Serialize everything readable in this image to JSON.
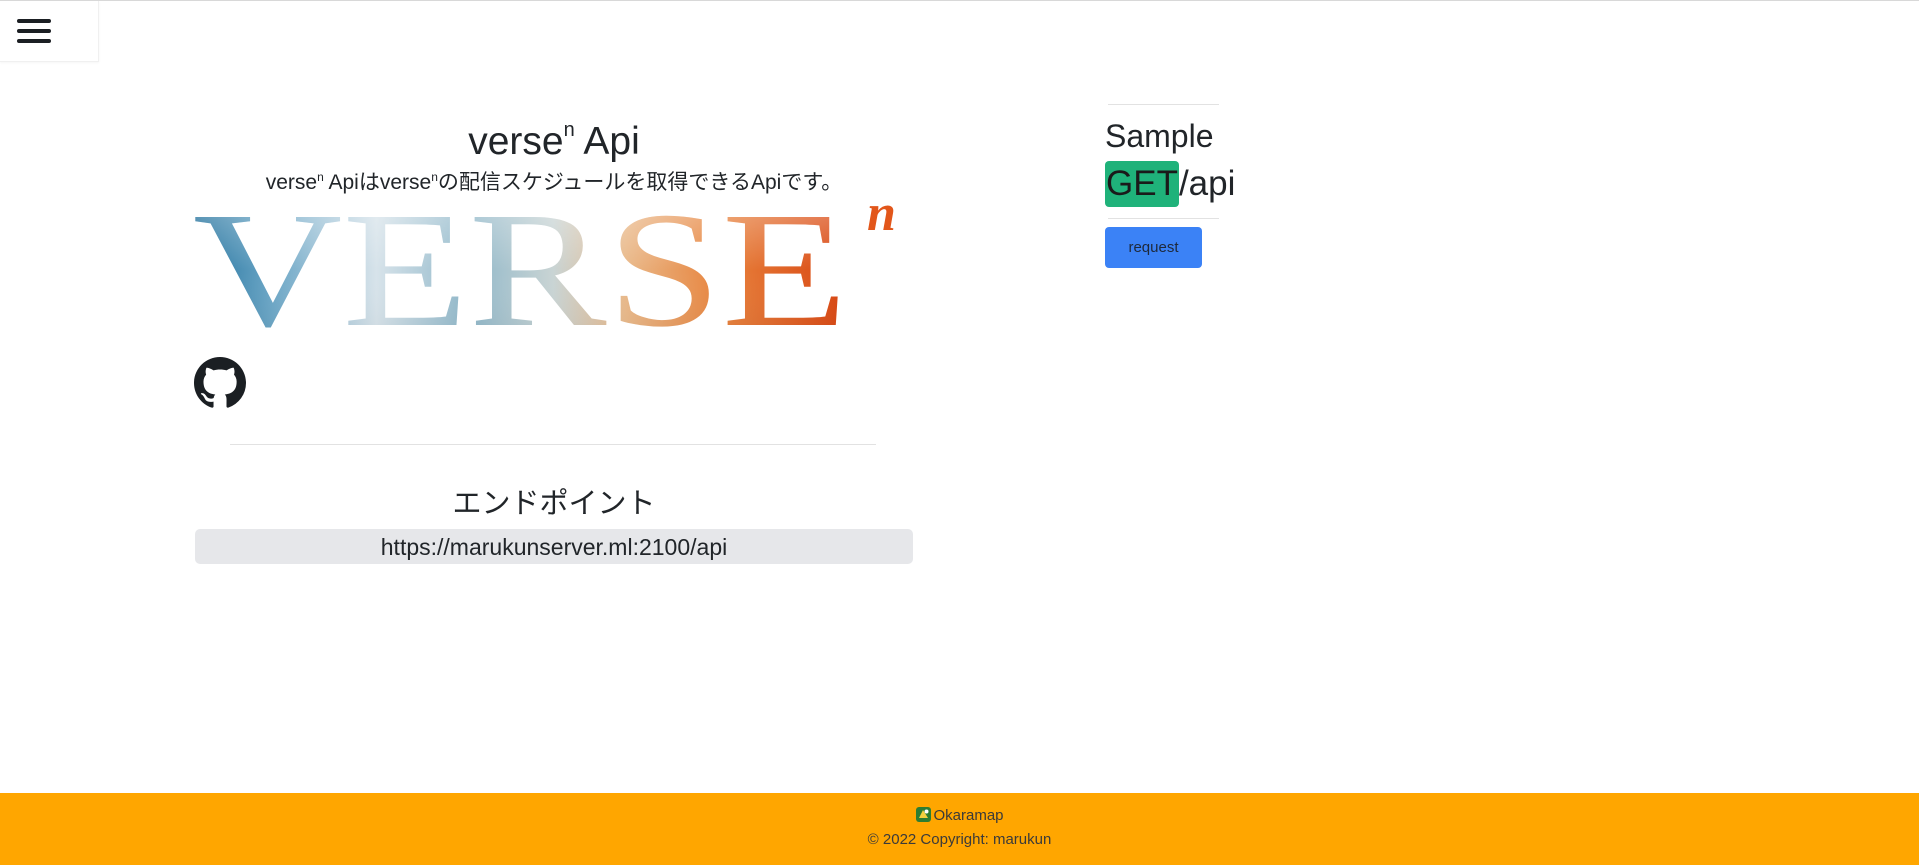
{
  "header": {
    "menu_icon": "hamburger-menu-icon"
  },
  "hero": {
    "title": "verse",
    "title_sup": "n",
    "title_suffix": " Api",
    "subtitle_a": "verse",
    "subtitle_sup_a": "n",
    "subtitle_b": " Apiはverse",
    "subtitle_sup_b": "n",
    "subtitle_c": "の配信スケジュールを取得できるApiです。",
    "logo_text": "VERSE",
    "logo_sup": "n",
    "github_icon": "github-icon"
  },
  "endpoint": {
    "heading": "エンドポイント",
    "url": "https://marukunserver.ml:2100/api"
  },
  "sample": {
    "label": "Sample",
    "method": "GET",
    "path": "/api",
    "request_label": "request",
    "method_color": "#1fb27a",
    "button_color": "#3b82f6"
  },
  "footer": {
    "link_text": "Okaramap",
    "link_icon": "okaramap-favicon-icon",
    "copyright": "© 2022 Copyright: marukun",
    "background": "#ffa600"
  }
}
